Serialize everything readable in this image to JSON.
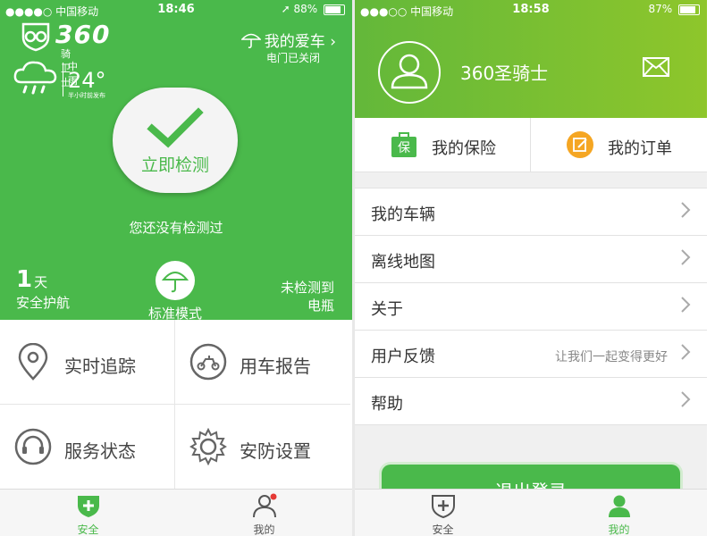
{
  "colors": {
    "brand_green": "#4ab94b",
    "gradient_green": "#8ec62b",
    "inactive_gray": "#555555",
    "badge_red": "#e53935",
    "order_yellow": "#f5a623"
  },
  "left": {
    "status": {
      "carrier": "●●●●○ 中国移动",
      "time": "18:46",
      "battery": "88%"
    },
    "logo": {
      "number": "360",
      "caption": "骑卫士"
    },
    "my_car": {
      "label": "我的爱车 ›",
      "sub": "电门已关闭"
    },
    "weather": {
      "condition": "中雨",
      "temperature": "24°",
      "updated": "半小时前发布",
      "icon": "rain-cloud-icon"
    },
    "check_button": {
      "label": "立即检测",
      "icon": "checkmark-icon"
    },
    "not_checked": "您还没有检测过",
    "guard_days": {
      "number": "1",
      "unit": "天",
      "label": "安全护航"
    },
    "mode": {
      "label": "标准模式",
      "icon": "umbrella-icon"
    },
    "battery_status": {
      "line1": "未检测到",
      "line2": "电瓶"
    },
    "grid": [
      {
        "label": "实时追踪",
        "icon": "location-pin-icon"
      },
      {
        "label": "用车报告",
        "icon": "scooter-icon"
      },
      {
        "label": "服务状态",
        "icon": "headset-icon"
      },
      {
        "label": "安防设置",
        "icon": "gear-icon"
      }
    ],
    "tabs": [
      {
        "label": "安全",
        "icon": "shield-plus-icon"
      },
      {
        "label": "我的",
        "icon": "person-icon"
      }
    ]
  },
  "right": {
    "status": {
      "carrier": "●●●○○ 中国移动",
      "time": "18:58",
      "battery": "87%"
    },
    "username": "360圣骑士",
    "quick": [
      {
        "label": "我的保险",
        "icon": "insurance-bag-icon",
        "badge": "保"
      },
      {
        "label": "我的订单",
        "icon": "order-edit-icon"
      }
    ],
    "menu": [
      {
        "label": "我的车辆",
        "hint": ""
      },
      {
        "label": "离线地图",
        "hint": ""
      },
      {
        "label": "关于",
        "hint": ""
      },
      {
        "label": "用户反馈",
        "hint": "让我们一起变得更好"
      },
      {
        "label": "帮助",
        "hint": ""
      }
    ],
    "logout": "退出登录",
    "tabs": [
      {
        "label": "安全",
        "icon": "shield-plus-icon"
      },
      {
        "label": "我的",
        "icon": "person-icon"
      }
    ]
  }
}
